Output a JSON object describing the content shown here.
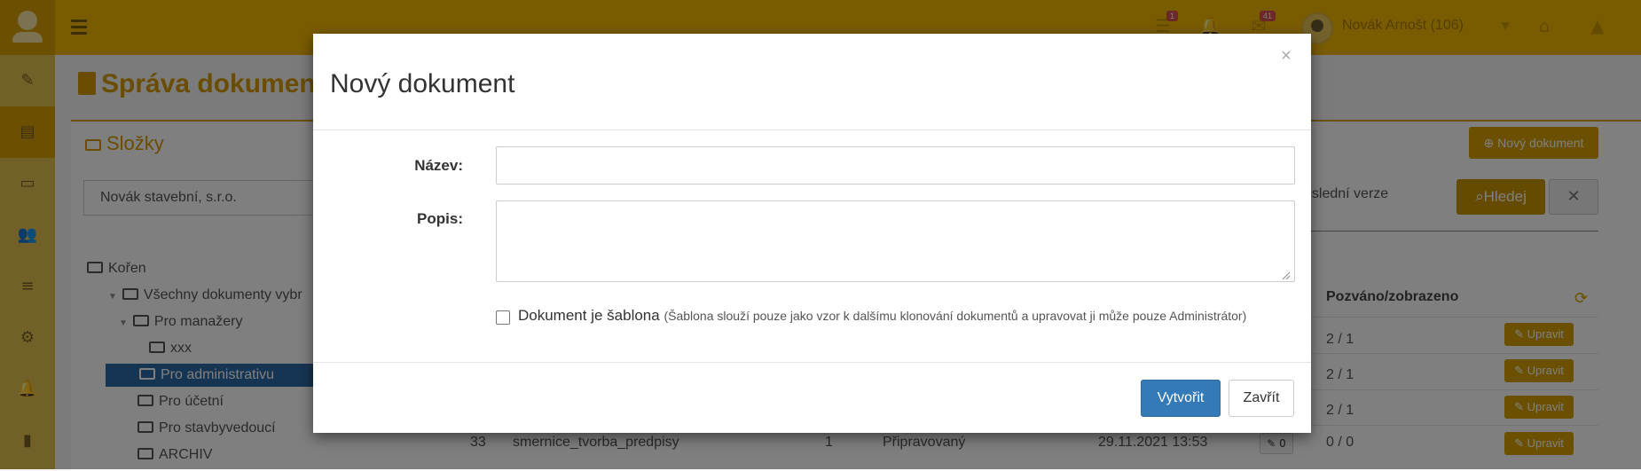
{
  "header": {
    "badges": {
      "tasks": "1",
      "messages": "41"
    },
    "user_name": "Novák Arnošt (106)"
  },
  "sidebar": {
    "items": [
      {
        "icon": "pencil-icon"
      },
      {
        "icon": "document-icon",
        "active": true
      },
      {
        "icon": "folder-icon"
      },
      {
        "icon": "users-icon"
      },
      {
        "icon": "list-icon"
      },
      {
        "icon": "settings-icon"
      },
      {
        "icon": "bell-icon"
      },
      {
        "icon": "book-icon"
      }
    ]
  },
  "page": {
    "title": "Správa dokumen"
  },
  "folders_panel": {
    "heading": "Složky",
    "company": "Novák stavební, s.r.o.",
    "tree": [
      {
        "label": "Kořen"
      },
      {
        "label": "Všechny dokumenty vybr"
      },
      {
        "label": "Pro manažery"
      },
      {
        "label": "xxx"
      },
      {
        "label": "Pro administrativu",
        "selected": true
      },
      {
        "label": "Pro účetní"
      },
      {
        "label": "Pro stavbyvedoucí"
      },
      {
        "label": "ARCHIV"
      }
    ]
  },
  "documents_panel": {
    "new_document_button": "Nový dokument",
    "last_version_text": "oslední verze",
    "search_button": "Hledej",
    "clear_button": "✕",
    "column_invited": "Pozváno/zobrazeno",
    "rows": [
      {
        "invited": "2 / 1",
        "action": "Upravit"
      },
      {
        "invited": "2 / 1",
        "action": "Upravit"
      },
      {
        "invited": "2 / 1",
        "action": "Upravit"
      },
      {
        "id": "33",
        "name": "smernice_tvorba_predpisy",
        "version": "1",
        "state": "Připravovaný",
        "date": "29.11.2021 13:53",
        "edits": "0",
        "invited": "0 / 0",
        "action": "Upravit"
      }
    ]
  },
  "modal": {
    "title": "Nový dokument",
    "close": "×",
    "name_label": "Název:",
    "name_value": "",
    "description_label": "Popis:",
    "description_value": "",
    "template_label": "Dokument je šablona",
    "template_note": "(Šablona slouží pouze jako vzor k dalšímu klonování dokumentů a upravovat ji může pouze Administrátor)",
    "template_checked": false,
    "create_button": "Vytvořit",
    "close_button": "Zavřít"
  },
  "colors": {
    "topbar": "#f5b800",
    "accent": "#d4a100",
    "primary_button": "#337ab7",
    "tree_selected": "#2c6aa6"
  }
}
